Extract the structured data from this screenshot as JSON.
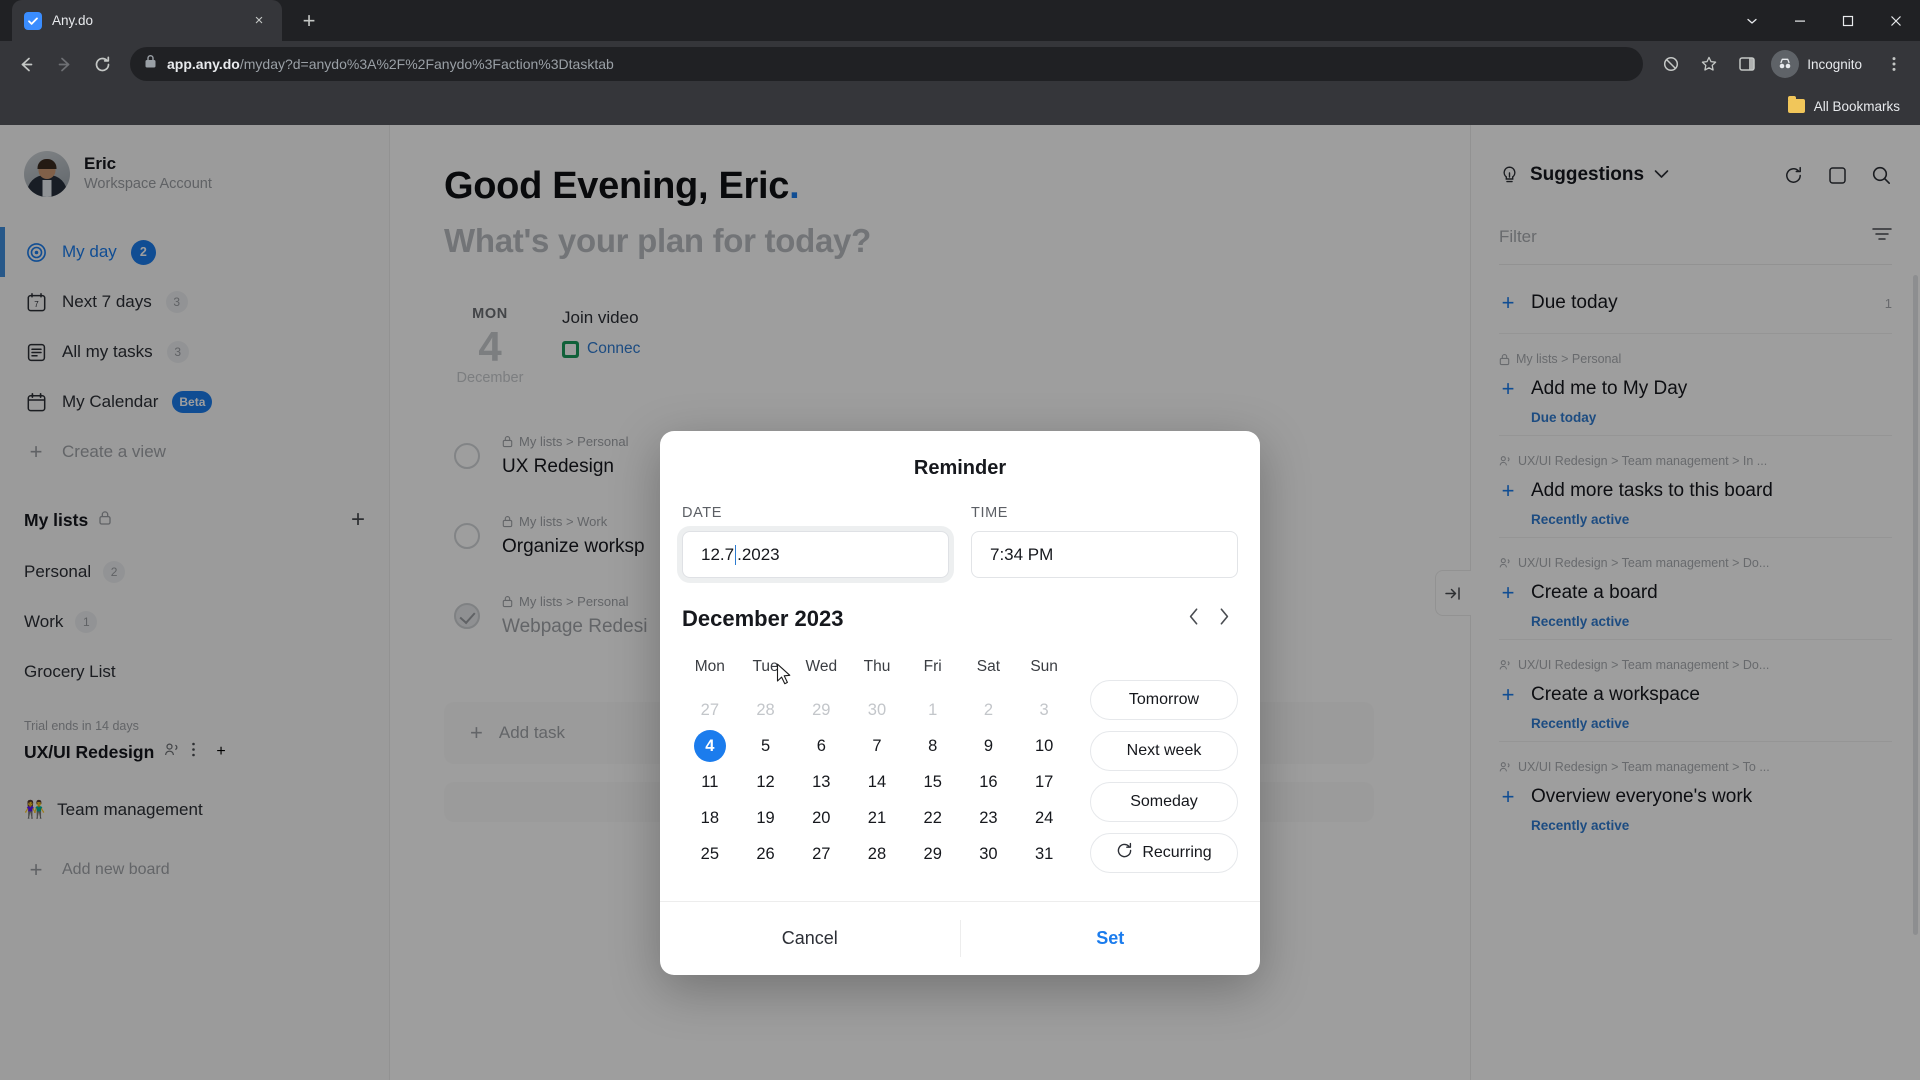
{
  "browser": {
    "tab_title": "Any.do",
    "url_bold": "app.any.do",
    "url_rest": "/myday?d=anydo%3A%2F%2Fanydo%3Faction%3Dtasktab",
    "profile_label": "Incognito",
    "bookmarks_label": "All Bookmarks",
    "new_tab_glyph": "+",
    "close_tab_glyph": "×"
  },
  "sidebar": {
    "user_name": "Eric",
    "user_subtitle": "Workspace Account",
    "nav": [
      {
        "label": "My day",
        "badge": "2",
        "badge_type": "blue",
        "active": true,
        "icon": "target-icon"
      },
      {
        "label": "Next 7 days",
        "badge": "3",
        "badge_type": "grey",
        "active": false,
        "icon": "calendar-7-icon"
      },
      {
        "label": "All my tasks",
        "badge": "3",
        "badge_type": "grey",
        "active": false,
        "icon": "list-icon"
      },
      {
        "label": "My Calendar",
        "badge": "Beta",
        "badge_type": "beta",
        "active": false,
        "icon": "calendar-icon"
      }
    ],
    "create_view_label": "Create a view",
    "my_lists_title": "My lists",
    "lists": [
      {
        "label": "Personal",
        "count": "2"
      },
      {
        "label": "Work",
        "count": "1"
      },
      {
        "label": "Grocery List",
        "count": ""
      }
    ],
    "trial_text": "Trial ends in 14 days",
    "board_title": "UX/UI Redesign",
    "board_items": [
      {
        "label": "Team management",
        "emoji": "👫"
      }
    ],
    "add_board_label": "Add new board"
  },
  "main": {
    "greeting": "Good Evening, Eric",
    "greeting_sub": "What's your plan for today?",
    "day": {
      "dow": "MON",
      "num": "4",
      "month": "December"
    },
    "meeting_title": "Join video",
    "meeting_link": "Connec",
    "tasks": [
      {
        "path": "My lists > Personal",
        "name": "UX Redesign",
        "done": false,
        "lock": "lock-icon"
      },
      {
        "path": "My lists > Work",
        "name": "Organize worksp",
        "done": false,
        "lock": "lock-icon"
      },
      {
        "path": "My lists > Personal",
        "name": "Webpage Redesi",
        "done": true,
        "lock": "lock-icon"
      }
    ],
    "add_task_label": "Add task"
  },
  "right_panel": {
    "title": "Suggestions",
    "filter_placeholder": "Filter",
    "due_today_label": "Due today",
    "due_today_count": "1",
    "items": [
      {
        "crumb": "My lists > Personal",
        "crumb_icon": "lock-icon",
        "title": "Add me to My Day",
        "sub": "Due today"
      },
      {
        "crumb": "UX/UI Redesign > Team management > In ...",
        "crumb_icon": "people-icon",
        "title": "Add more tasks to this board",
        "sub": "Recently active"
      },
      {
        "crumb": "UX/UI Redesign > Team management > Do...",
        "crumb_icon": "people-icon",
        "title": "Create a board",
        "sub": "Recently active"
      },
      {
        "crumb": "UX/UI Redesign > Team management > Do...",
        "crumb_icon": "people-icon",
        "title": "Create a workspace",
        "sub": "Recently active"
      },
      {
        "crumb": "UX/UI Redesign > Team management > To ...",
        "crumb_icon": "people-icon",
        "title": "Overview everyone's work",
        "sub": "Recently active"
      }
    ]
  },
  "dialog": {
    "title": "Reminder",
    "date_label": "DATE",
    "date_value_before": "12.7",
    "date_value_after": ".2023",
    "date_value_full": "12.7.2023",
    "time_label": "TIME",
    "time_value": "7:34 PM",
    "month_title": "December 2023",
    "prev_glyph": "‹",
    "next_glyph": "›",
    "weekdays": [
      "Mon",
      "Tue",
      "Wed",
      "Thu",
      "Fri",
      "Sat",
      "Sun"
    ],
    "weeks": [
      [
        {
          "d": "27",
          "out": true
        },
        {
          "d": "28",
          "out": true
        },
        {
          "d": "29",
          "out": true
        },
        {
          "d": "30",
          "out": true
        },
        {
          "d": "1",
          "out": true
        },
        {
          "d": "2",
          "out": true
        },
        {
          "d": "3",
          "out": true
        }
      ],
      [
        {
          "d": "4",
          "sel": true
        },
        {
          "d": "5"
        },
        {
          "d": "6"
        },
        {
          "d": "7"
        },
        {
          "d": "8"
        },
        {
          "d": "9"
        },
        {
          "d": "10"
        }
      ],
      [
        {
          "d": "11"
        },
        {
          "d": "12"
        },
        {
          "d": "13"
        },
        {
          "d": "14"
        },
        {
          "d": "15"
        },
        {
          "d": "16"
        },
        {
          "d": "17"
        }
      ],
      [
        {
          "d": "18"
        },
        {
          "d": "19"
        },
        {
          "d": "20"
        },
        {
          "d": "21"
        },
        {
          "d": "22"
        },
        {
          "d": "23"
        },
        {
          "d": "24"
        }
      ],
      [
        {
          "d": "25"
        },
        {
          "d": "26"
        },
        {
          "d": "27"
        },
        {
          "d": "28"
        },
        {
          "d": "29"
        },
        {
          "d": "30"
        },
        {
          "d": "31"
        }
      ]
    ],
    "quick_buttons": [
      {
        "label": "Tomorrow",
        "icon": ""
      },
      {
        "label": "Next week",
        "icon": ""
      },
      {
        "label": "Someday",
        "icon": ""
      },
      {
        "label": "Recurring",
        "icon": "recurring-icon"
      }
    ],
    "cancel_label": "Cancel",
    "set_label": "Set"
  },
  "colors": {
    "accent": "#1b7ced",
    "link": "#2f7bd0",
    "chrome_bg": "#35363a",
    "chrome_dark": "#202124"
  }
}
